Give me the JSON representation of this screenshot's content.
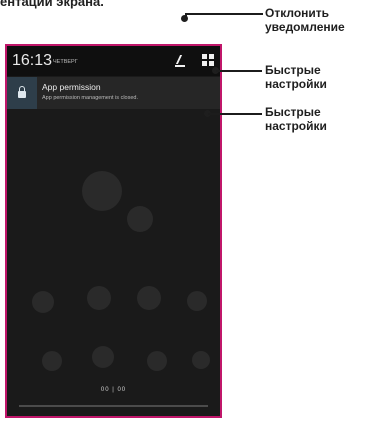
{
  "page": {
    "cutoff_heading": "ентации экрана."
  },
  "status_bar": {
    "time": "16:13",
    "date": "ЧЕТВЕРГ"
  },
  "notification": {
    "title": "App permission",
    "text": "App permission management is closed."
  },
  "handle": {
    "text": "00 | 00"
  },
  "callouts": {
    "dismiss": "Отклонить уведомление",
    "quick_settings_1": "Быстрые настройки",
    "quick_settings_2": "Быстрые настройки"
  },
  "colors": {
    "frame": "#c0166a",
    "lock_bg": "#2e3e4a"
  }
}
